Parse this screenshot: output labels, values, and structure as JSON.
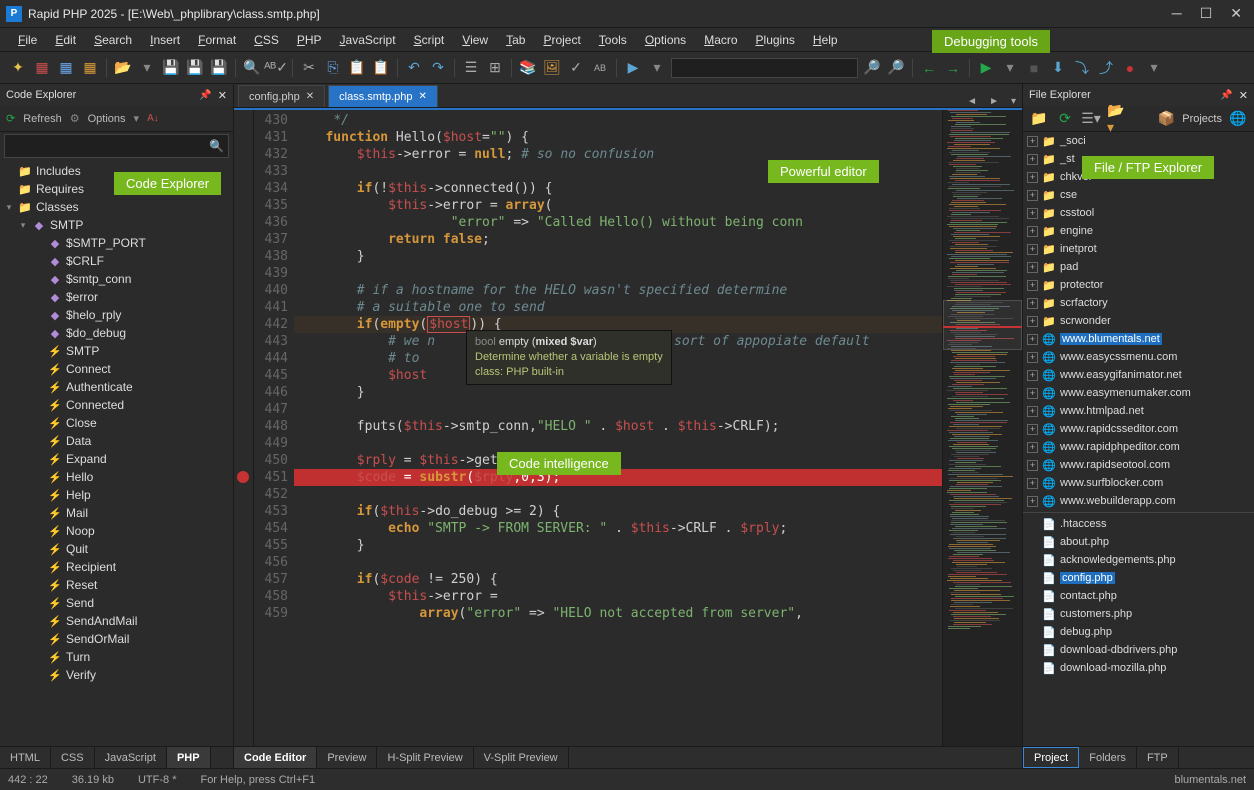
{
  "title": "Rapid PHP 2025 - [E:\\Web\\_phplibrary\\class.smtp.php]",
  "menus": [
    "File",
    "Edit",
    "Search",
    "Insert",
    "Format",
    "CSS",
    "PHP",
    "JavaScript",
    "Script",
    "View",
    "Tab",
    "Project",
    "Tools",
    "Options",
    "Macro",
    "Plugins",
    "Help"
  ],
  "callouts": {
    "debug": "Debugging tools",
    "codeexp": "Code Explorer",
    "editor": "Powerful editor",
    "fileexp": "File / FTP Explorer",
    "intel": "Code intelligence"
  },
  "panels": {
    "left_title": "Code Explorer",
    "right_title": "File Explorer",
    "refresh": "Refresh",
    "options": "Options",
    "projects": "Projects"
  },
  "code_tree": {
    "includes": "Includes",
    "requires": "Requires",
    "classes": "Classes",
    "class_name": "SMTP",
    "members": [
      "$SMTP_PORT",
      "$CRLF",
      "$smtp_conn",
      "$error",
      "$helo_rply",
      "$do_debug"
    ],
    "methods": [
      "SMTP",
      "Connect",
      "Authenticate",
      "Connected",
      "Close",
      "Data",
      "Expand",
      "Hello",
      "Help",
      "Mail",
      "Noop",
      "Quit",
      "Recipient",
      "Reset",
      "Send",
      "SendAndMail",
      "SendOrMail",
      "Turn",
      "Verify"
    ]
  },
  "tabs": [
    "config.php",
    "class.smtp.php"
  ],
  "active_tab": 1,
  "line_start": 430,
  "line_end": 459,
  "breakpoint_line": 451,
  "active_line": 442,
  "tooltip": {
    "sig": "bool empty (mixed $var)",
    "desc": "Determine whether a variable is empty",
    "class": "class: PHP built-in"
  },
  "editor_tabs": [
    "Code Editor",
    "Preview",
    "H-Split Preview",
    "V-Split Preview"
  ],
  "lang_tabs": [
    "HTML",
    "CSS",
    "JavaScript",
    "PHP"
  ],
  "fe_folders": [
    "_soci",
    "_st",
    "chkver",
    "cse",
    "csstool",
    "engine",
    "inetprot",
    "pad",
    "protector",
    "scrfactory",
    "scrwonder",
    "www.blumentals.net",
    "www.easycssmenu.com",
    "www.easygifanimator.net",
    "www.easymenumaker.com",
    "www.htmlpad.net",
    "www.rapidcsseditor.com",
    "www.rapidphpeditor.com",
    "www.rapidseotool.com",
    "www.surfblocker.com",
    "www.webuilderapp.com"
  ],
  "fe_selected": 11,
  "fe_red": [
    15,
    16,
    17,
    18
  ],
  "fe_files": [
    ".htaccess",
    "about.php",
    "acknowledgements.php",
    "config.php",
    "contact.php",
    "customers.php",
    "debug.php",
    "download-dbdrivers.php",
    "download-mozilla.php"
  ],
  "fe_file_selected": 3,
  "fe_tabs": [
    "Project",
    "Folders",
    "FTP"
  ],
  "status": {
    "pos": "442 : 22",
    "size": "36.19 kb",
    "enc": "UTF-8 *",
    "help": "For Help, press Ctrl+F1",
    "site": "blumentals.net"
  }
}
